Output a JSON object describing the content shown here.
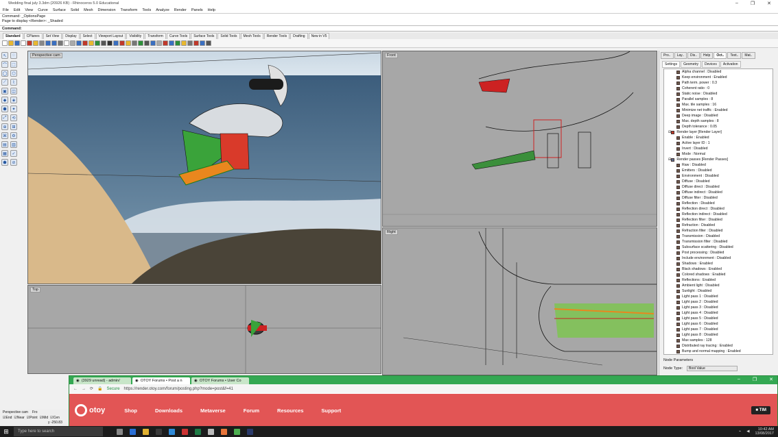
{
  "window": {
    "title": "Wedding final july 3.3dm (20926 KB) - Rhinoceros 5.0 Educational",
    "controls": [
      "–",
      "❐",
      "✕"
    ]
  },
  "menu": [
    "File",
    "Edit",
    "View",
    "Curve",
    "Surface",
    "Solid",
    "Mesh",
    "Dimension",
    "Transform",
    "Tools",
    "Analyze",
    "Render",
    "Panels",
    "Help"
  ],
  "command": {
    "history": [
      "Command: _OptionsPage",
      "Page to display <Render>: _Shaded"
    ],
    "prompt": "Command:"
  },
  "toolbar_tabs": [
    "Standard",
    "CPlanes",
    "Set View",
    "Display",
    "Select",
    "Viewport Layout",
    "Visibility",
    "Transform",
    "Curve Tools",
    "Surface Tools",
    "Solid Tools",
    "Mesh Tools",
    "Render Tools",
    "Drafting",
    "New in V5"
  ],
  "toolbar_tab_active": 0,
  "left_tool_icons": [
    "↖",
    "◌",
    "⌒",
    "⬚",
    "◯",
    "⬡",
    "⟋",
    "⌇",
    "▣",
    "◫",
    "◆",
    "◈",
    "⬢",
    "✦",
    "⤢",
    "⟲",
    "⊕",
    "⊞",
    "⌘",
    "⚙",
    "▤",
    "▥",
    "▦",
    "✓",
    "⬟",
    "⊘"
  ],
  "viewports": {
    "perspective": {
      "label": "Perspective cam"
    },
    "front": {
      "label": "Front"
    },
    "top": {
      "label": "Top"
    },
    "right": {
      "label": "Right"
    }
  },
  "panel": {
    "tabs": [
      "Pro..",
      "Lay..",
      "Dis..",
      "Help",
      "Oct..",
      "Text..",
      "Mat.."
    ],
    "active_tab": 4,
    "subtabs": [
      "Settings",
      "Geometry",
      "Devices",
      "Activation"
    ],
    "tree": [
      {
        "t": "Alpha channel : Disabled",
        "g": 0
      },
      {
        "t": "Keep environment : Enabled",
        "g": 0
      },
      {
        "t": "Path term. power : 0.3",
        "g": 0
      },
      {
        "t": "Coherent ratio : 0",
        "g": 0
      },
      {
        "t": "Static noise : Disabled",
        "g": 0
      },
      {
        "t": "Parallel samples : 8",
        "g": 0
      },
      {
        "t": "Max. tile samples : 16",
        "g": 0
      },
      {
        "t": "Minimize net traffic : Enabled",
        "g": 0
      },
      {
        "t": "Deep image : Disabled",
        "g": 0
      },
      {
        "t": "Max. depth samples : 8",
        "g": 0
      },
      {
        "t": "Depth tolerance : 0.05",
        "g": 0
      },
      {
        "t": "Render layer [Render Layer]",
        "g": 1
      },
      {
        "t": "Enable : Enabled",
        "g": 0
      },
      {
        "t": "Active layer ID : 1",
        "g": 0
      },
      {
        "t": "Invert : Disabled",
        "g": 0
      },
      {
        "t": "Mode : Normal",
        "g": 0
      },
      {
        "t": "Render passes [Render Passes]",
        "g": 2
      },
      {
        "t": "Raw : Disabled",
        "g": 0
      },
      {
        "t": "Emitters : Disabled",
        "g": 0
      },
      {
        "t": "Environment : Disabled",
        "g": 0
      },
      {
        "t": "Diffuse : Disabled",
        "g": 0
      },
      {
        "t": "Diffuse direct : Disabled",
        "g": 0
      },
      {
        "t": "Diffuse indirect : Disabled",
        "g": 0
      },
      {
        "t": "Diffuse filter : Disabled",
        "g": 0
      },
      {
        "t": "Reflection : Disabled",
        "g": 0
      },
      {
        "t": "Reflection direct : Disabled",
        "g": 0
      },
      {
        "t": "Reflection indirect : Disabled",
        "g": 0
      },
      {
        "t": "Reflection filter : Disabled",
        "g": 0
      },
      {
        "t": "Refraction : Disabled",
        "g": 0
      },
      {
        "t": "Refraction filter : Disabled",
        "g": 0
      },
      {
        "t": "Transmission : Disabled",
        "g": 0
      },
      {
        "t": "Transmission filter : Disabled",
        "g": 0
      },
      {
        "t": "Subsurface scattering : Disabled",
        "g": 0
      },
      {
        "t": "Post processing : Disabled",
        "g": 0
      },
      {
        "t": "Include environment : Disabled",
        "g": 0
      },
      {
        "t": "Shadows : Enabled",
        "g": 0
      },
      {
        "t": "Black shadows : Enabled",
        "g": 0
      },
      {
        "t": "Colored shadows : Enabled",
        "g": 0
      },
      {
        "t": "Reflections : Enabled",
        "g": 0
      },
      {
        "t": "Ambient light : Disabled",
        "g": 0
      },
      {
        "t": "Sunlight : Disabled",
        "g": 0
      },
      {
        "t": "Light pass 1 : Disabled",
        "g": 0
      },
      {
        "t": "Light pass 2 : Disabled",
        "g": 0
      },
      {
        "t": "Light pass 3 : Disabled",
        "g": 0
      },
      {
        "t": "Light pass 4 : Disabled",
        "g": 0
      },
      {
        "t": "Light pass 5 : Disabled",
        "g": 0
      },
      {
        "t": "Light pass 6 : Disabled",
        "g": 0
      },
      {
        "t": "Light pass 7 : Disabled",
        "g": 0
      },
      {
        "t": "Light pass 8 : Disabled",
        "g": 0
      },
      {
        "t": "Max samples : 128",
        "g": 0
      },
      {
        "t": "Distributed ray tracing : Enabled",
        "g": 0
      },
      {
        "t": "Bump and normal mapping : Enabled",
        "g": 0
      }
    ],
    "node_params_label": "Node Parameters",
    "node_type_label": "Node Type:",
    "node_type_value": "Bool Value"
  },
  "browser": {
    "tabs": [
      {
        "title": "(3929 unread) - admin/",
        "active": false
      },
      {
        "title": "OTOY Forums • Post a n",
        "active": true
      },
      {
        "title": "OTOY Forums • User Co",
        "active": false
      }
    ],
    "controls": [
      "–",
      "❐",
      "✕"
    ],
    "secure_label": "Secure",
    "url": "https://render.otoy.com/forum/posting.php?mode=post&f=41",
    "logo": "otoy",
    "nav": [
      "Shop",
      "Downloads",
      "Metaverse",
      "Forum",
      "Resources",
      "Support"
    ],
    "user": "TIM"
  },
  "status": {
    "viewport": "Perspective cam",
    "fro": "Fro",
    "snaps": [
      "End",
      "Near",
      "Point",
      "Mid",
      "Cen"
    ],
    "coord": "y -250.83"
  },
  "taskbar": {
    "search_placeholder": "Type here to search",
    "time": "10:42 AM",
    "date": "13/08/2017"
  },
  "colors": {
    "browser_tab_green": "#34a853",
    "otoy_red": "#e25555",
    "rhino_bg": "#a7a7a7"
  }
}
